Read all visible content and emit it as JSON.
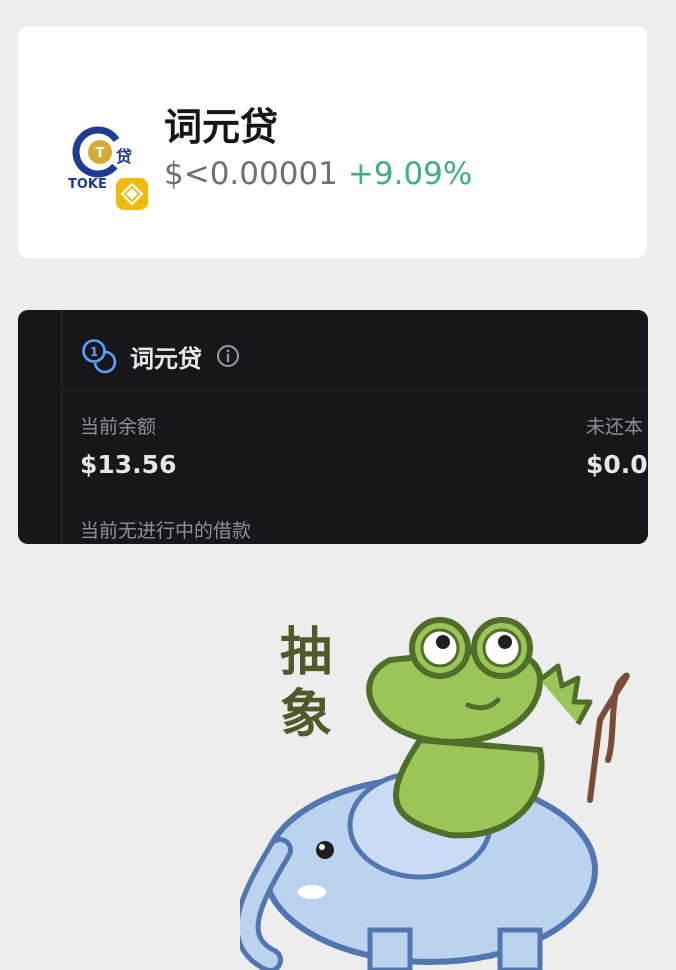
{
  "token": {
    "name": "词元贷",
    "price": "$<0.00001",
    "change": "+9.09%",
    "logo_text": "TOKE",
    "logo_glyph": "贷",
    "chain_badge_icon": "bnb-chain-icon"
  },
  "loan_panel": {
    "title": "词元贷",
    "stats": [
      {
        "label": "当前余额",
        "value": "$13.56"
      },
      {
        "label": "未还本",
        "value": "$0.0"
      }
    ],
    "note": "当前无进行中的借款"
  },
  "sticker": {
    "caption_line1": "抽",
    "caption_line2": "象"
  },
  "colors": {
    "background": "#ededed",
    "card": "#ffffff",
    "panel": "#16161b",
    "positive": "#3fb07a",
    "accent_blue": "#5aa2ff"
  }
}
